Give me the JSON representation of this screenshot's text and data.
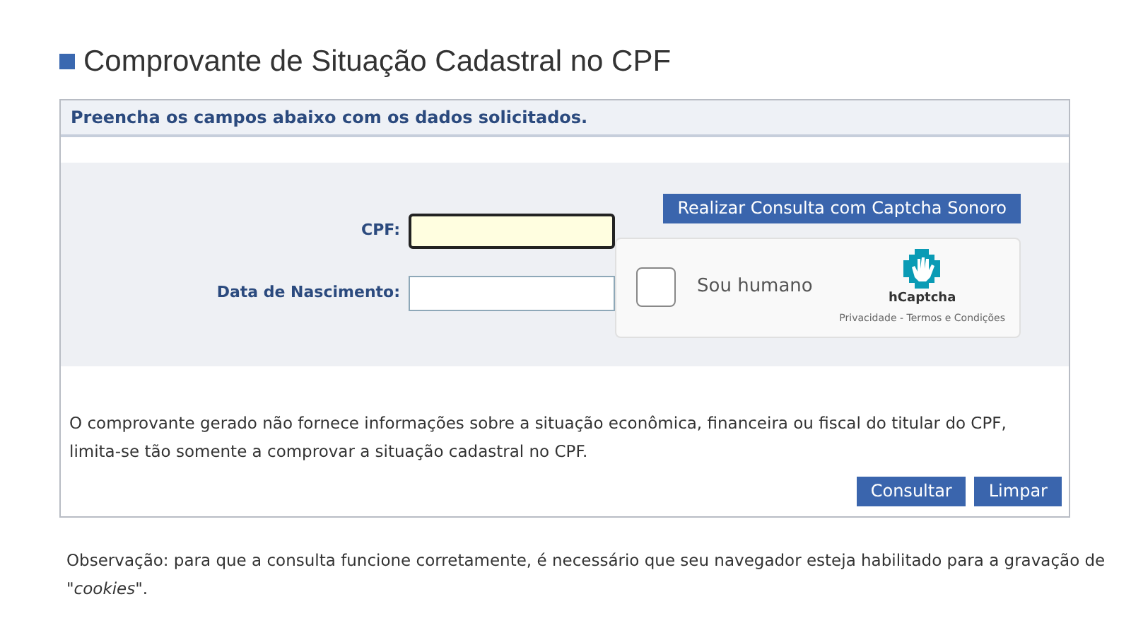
{
  "title": "Comprovante de Situação Cadastral no CPF",
  "form_header": "Preencha os campos abaixo com os dados solicitados.",
  "fields": [
    {
      "label": "CPF:",
      "focused": true
    },
    {
      "label": "Data de Nascimento:",
      "focused": false
    }
  ],
  "audio_captcha_button": "Realizar Consulta com Captcha Sonoro",
  "captcha": {
    "label": "Sou humano",
    "checked": false,
    "brand": "hCaptcha",
    "links": "Privacidade - Termos e Condições"
  },
  "disclaimer": "O comprovante gerado não fornece informações sobre a situação econômica, financeira ou fiscal do titular do CPF, limita-se tão somente a comprovar a situação cadastral no CPF.",
  "buttons": [
    "Consultar",
    "Limpar"
  ],
  "note": "Observação: para que a consulta funcione corretamente, é necessário que seu navegador esteja habilitado para a gravação de \"*cookies*\"."
}
